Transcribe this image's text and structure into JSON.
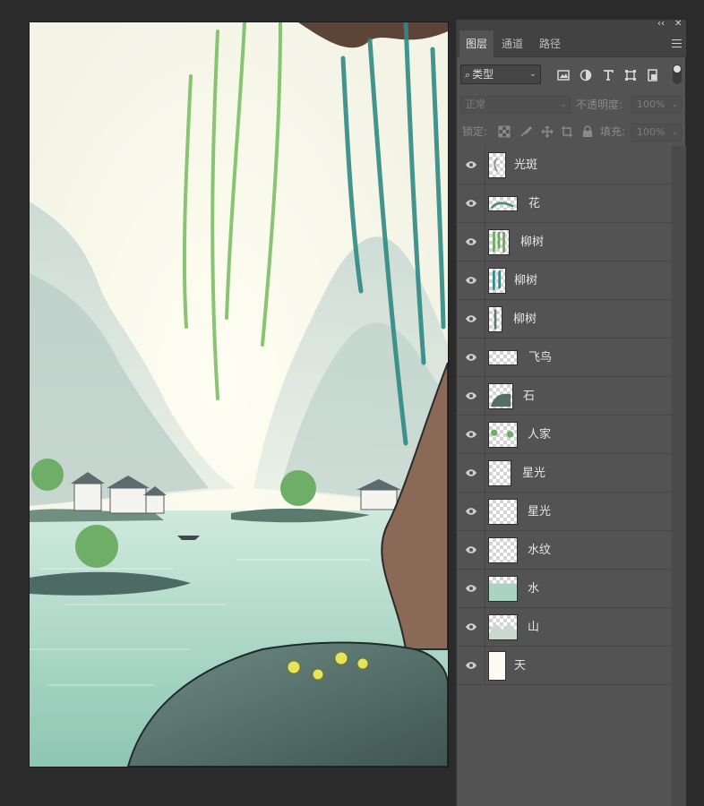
{
  "panel": {
    "collapse_icon": "double-chevron-left",
    "close_icon": "close",
    "tabs": [
      {
        "label": "图层",
        "active": true
      },
      {
        "label": "通道",
        "active": false
      },
      {
        "label": "路径",
        "active": false
      }
    ],
    "filter": {
      "label": "类型",
      "icons": [
        "image-filter-icon",
        "adjustment-filter-icon",
        "type-filter-icon",
        "shape-filter-icon",
        "smart-object-filter-icon"
      ]
    },
    "blend_mode": "正常",
    "opacity_label": "不透明度:",
    "opacity_value": "100%",
    "lock_label": "锁定:",
    "fill_label": "填充:",
    "fill_value": "100%"
  },
  "layers": [
    {
      "name": "光斑",
      "visible": true
    },
    {
      "name": "花",
      "visible": true
    },
    {
      "name": "柳树",
      "visible": true
    },
    {
      "name": "柳树",
      "visible": true
    },
    {
      "name": "柳树",
      "visible": true
    },
    {
      "name": "飞鸟",
      "visible": true
    },
    {
      "name": "石",
      "visible": true
    },
    {
      "name": "人家",
      "visible": true
    },
    {
      "name": "星光",
      "visible": true
    },
    {
      "name": "星光",
      "visible": true
    },
    {
      "name": "水纹",
      "visible": true
    },
    {
      "name": "水",
      "visible": true
    },
    {
      "name": "山",
      "visible": true
    },
    {
      "name": "天",
      "visible": true
    }
  ],
  "colors": {
    "panel_bg": "#535353",
    "tabbar_bg": "#424242",
    "app_bg": "#2b2b2b",
    "sky": "#fbfbf1",
    "water": "#a9d4c4",
    "willow_green": "#7fbf6a",
    "trunk": "#7a5a4a"
  }
}
